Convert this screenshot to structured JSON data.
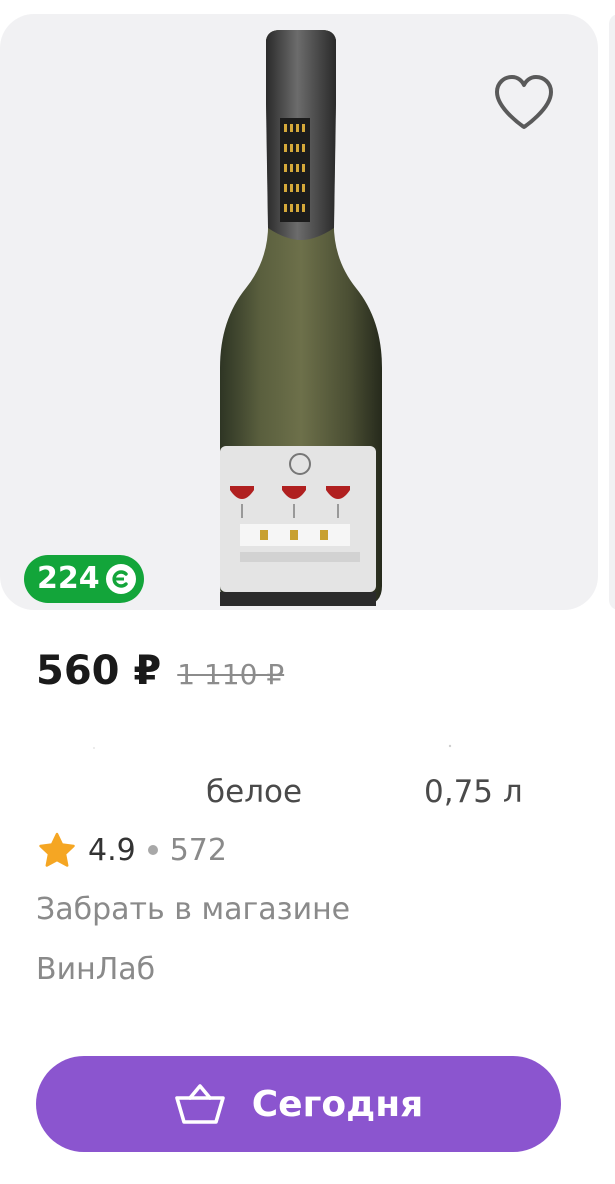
{
  "product": {
    "bonus_points": "224",
    "price": "560 ₽",
    "old_price": "1 110 ₽",
    "color": "белое",
    "volume": "0,75 л",
    "rating": "4.9",
    "reviews_count": "572",
    "pickup_text": "Забрать в магазине",
    "store_name": "ВинЛаб"
  },
  "actions": {
    "cart_button_label": "Сегодня"
  },
  "icons": {
    "favorite": "heart-outline-icon",
    "bonus": "bonus-coin-icon",
    "rating": "star-icon",
    "cart": "basket-icon"
  },
  "colors": {
    "bonus_badge": "#13a53a",
    "cta_button": "#8b55cf",
    "star": "#f5a623",
    "image_bg": "#f1f1f3"
  }
}
